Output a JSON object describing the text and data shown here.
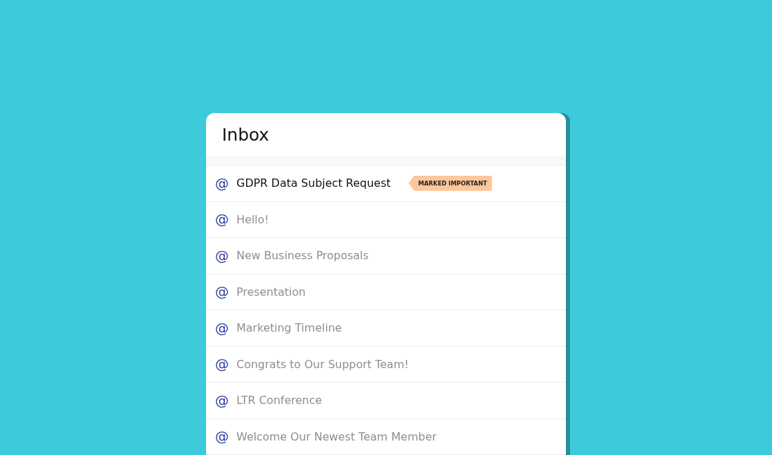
{
  "title": "Inbox",
  "messages": [
    {
      "icon": "@",
      "subject": "GDPR Data Subject Request",
      "unread": true,
      "badge": "MARKED IMPORTANT"
    },
    {
      "icon": "@",
      "subject": "Hello!",
      "unread": false
    },
    {
      "icon": "@",
      "subject": "New Business Proposals",
      "unread": false
    },
    {
      "icon": "@",
      "subject": "Presentation",
      "unread": false
    },
    {
      "icon": "@",
      "subject": "Marketing Timeline",
      "unread": false
    },
    {
      "icon": "@",
      "subject": "Congrats to Our Support Team!",
      "unread": false
    },
    {
      "icon": "@",
      "subject": "LTR Conference",
      "unread": false
    },
    {
      "icon": "@",
      "subject": "Welcome Our Newest Team Member",
      "unread": false
    }
  ]
}
